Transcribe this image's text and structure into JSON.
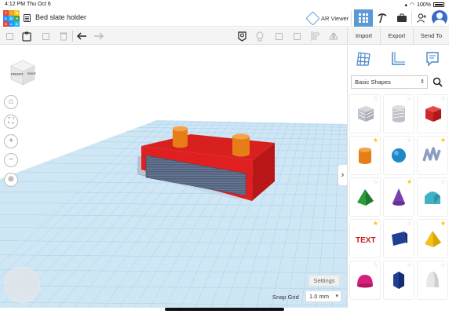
{
  "status": {
    "time": "4:12 PM",
    "date": "Thu Oct 6",
    "battery": "100%"
  },
  "logo": {
    "letters": [
      "T",
      "I",
      "N",
      "K",
      "E",
      "R",
      "C",
      "A",
      "D"
    ]
  },
  "header": {
    "title": "Bed slate holder",
    "ar_label": "AR Viewer"
  },
  "toolbar": {
    "import": "Import",
    "export": "Export",
    "send_to": "Send To"
  },
  "viewcube": {
    "front": "FRONT",
    "right": "RIGHT"
  },
  "viewport": {
    "settings_label": "Settings",
    "snap_label": "Snap Grid",
    "snap_value": "1.0 mm"
  },
  "panel": {
    "category": "Basic Shapes",
    "shapes": [
      {
        "name": "box-hole",
        "star": "none"
      },
      {
        "name": "cylinder-hole",
        "star": "none"
      },
      {
        "name": "box",
        "star": "none"
      },
      {
        "name": "cylinder",
        "star": "gold"
      },
      {
        "name": "sphere",
        "star": "none"
      },
      {
        "name": "scribble",
        "star": "gold"
      },
      {
        "name": "pyramid",
        "star": "none"
      },
      {
        "name": "cone",
        "star": "gold"
      },
      {
        "name": "roof",
        "star": "none"
      },
      {
        "name": "text",
        "star": "gold"
      },
      {
        "name": "wedge",
        "star": "none"
      },
      {
        "name": "pyramid-yellow",
        "star": "gold"
      },
      {
        "name": "half-sphere",
        "star": "none"
      },
      {
        "name": "polygon",
        "star": "none"
      },
      {
        "name": "paraboloid",
        "star": "none"
      }
    ]
  },
  "colors": {
    "accent": "#5b9bd5",
    "workplane": "#cfe6f5",
    "grid_line": "#9cc8e6",
    "shape_red": "#e02020",
    "shape_orange": "#f08a1e"
  }
}
